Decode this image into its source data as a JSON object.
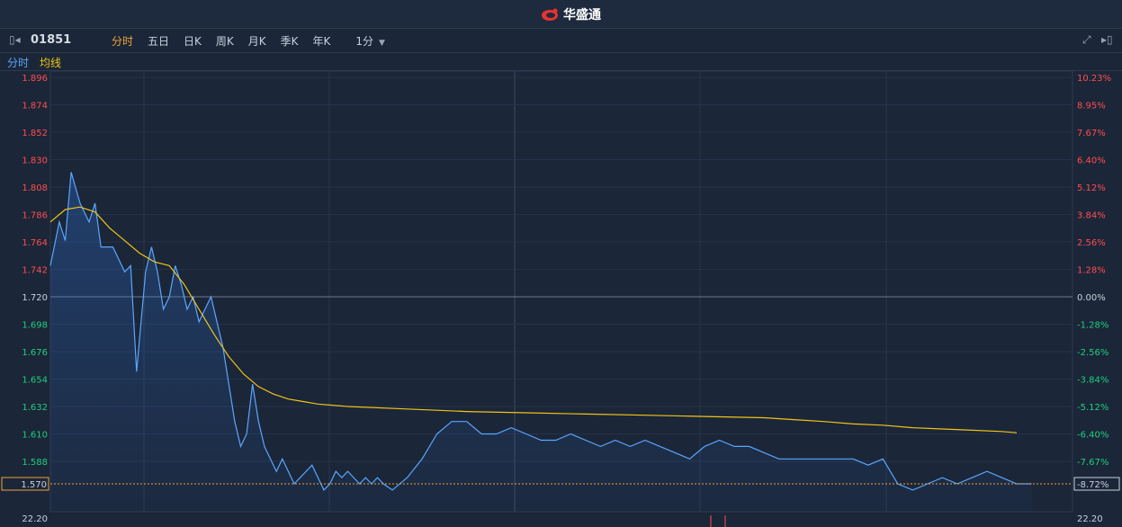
{
  "header": {
    "brand": "华盛通"
  },
  "toolbar": {
    "symbol": "01851",
    "tabs": [
      "分时",
      "五日",
      "日K",
      "周K",
      "月K",
      "季K",
      "年K"
    ],
    "interval": "1分"
  },
  "legend": {
    "series1": "分时",
    "series2": "均线"
  },
  "colors": {
    "background": "#1b2638",
    "price_line": "#5aa6ff",
    "avg_line": "#f0c419",
    "up": "#ff4d4f",
    "down": "#1fcf7e",
    "neutral": "#c9d1dc",
    "current_marker": "#f0a23a"
  },
  "chart_data": {
    "type": "line",
    "prev_close": 1.72,
    "current_price": 1.57,
    "current_pct": "-8.72%",
    "ylim": [
      1.565,
      1.9
    ],
    "left_ticks": [
      "1.896",
      "1.874",
      "1.852",
      "1.830",
      "1.808",
      "1.786",
      "1.764",
      "1.742",
      "1.720",
      "1.698",
      "1.676",
      "1.654",
      "1.632",
      "1.610",
      "1.588",
      "1.570"
    ],
    "right_ticks": [
      "10.23%",
      "8.95%",
      "7.67%",
      "6.40%",
      "5.12%",
      "3.84%",
      "2.56%",
      "1.28%",
      "0.00%",
      "-1.28%",
      "-2.56%",
      "-3.84%",
      "-5.12%",
      "-6.40%",
      "-7.67%",
      "-8.72%"
    ],
    "volume_label_left": "22.20",
    "volume_label_right": "22.20",
    "x_minutes": 330,
    "series": [
      {
        "name": "分时",
        "x": [
          0,
          3,
          5,
          7,
          10,
          13,
          15,
          17,
          19,
          21,
          23,
          25,
          27,
          29,
          32,
          34,
          36,
          38,
          40,
          42,
          44,
          46,
          48,
          50,
          52,
          54,
          56,
          58,
          60,
          62,
          64,
          66,
          68,
          70,
          72,
          74,
          76,
          78,
          80,
          82,
          84,
          86,
          88,
          90,
          92,
          94,
          96,
          98,
          100,
          102,
          104,
          106,
          108,
          110,
          112,
          115,
          120,
          125,
          130,
          135,
          140,
          145,
          150,
          155,
          160,
          165,
          170,
          175,
          180,
          185,
          190,
          195,
          200,
          205,
          210,
          215,
          220,
          225,
          230,
          235,
          240,
          245,
          250,
          255,
          260,
          265,
          270,
          275,
          280,
          285,
          290,
          295,
          300,
          305,
          310,
          315,
          320,
          325,
          330
        ],
        "values": [
          1.745,
          1.78,
          1.765,
          1.82,
          1.795,
          1.78,
          1.795,
          1.76,
          1.76,
          1.76,
          1.75,
          1.74,
          1.745,
          1.66,
          1.74,
          1.76,
          1.74,
          1.71,
          1.72,
          1.745,
          1.73,
          1.71,
          1.72,
          1.7,
          1.71,
          1.72,
          1.7,
          1.68,
          1.65,
          1.62,
          1.6,
          1.61,
          1.65,
          1.62,
          1.6,
          1.59,
          1.58,
          1.59,
          1.58,
          1.57,
          1.575,
          1.58,
          1.585,
          1.575,
          1.565,
          1.57,
          1.58,
          1.575,
          1.58,
          1.575,
          1.57,
          1.575,
          1.57,
          1.575,
          1.57,
          1.565,
          1.575,
          1.59,
          1.61,
          1.62,
          1.62,
          1.61,
          1.61,
          1.615,
          1.61,
          1.605,
          1.605,
          1.61,
          1.605,
          1.6,
          1.605,
          1.6,
          1.605,
          1.6,
          1.595,
          1.59,
          1.6,
          1.605,
          1.6,
          1.6,
          1.595,
          1.59,
          1.59,
          1.59,
          1.59,
          1.59,
          1.59,
          1.585,
          1.59,
          1.57,
          1.565,
          1.57,
          1.575,
          1.57,
          1.575,
          1.58,
          1.575,
          1.57,
          1.57
        ]
      },
      {
        "name": "均线",
        "x": [
          0,
          5,
          10,
          15,
          20,
          25,
          30,
          35,
          40,
          45,
          50,
          55,
          60,
          65,
          70,
          75,
          80,
          85,
          90,
          100,
          120,
          140,
          160,
          180,
          200,
          220,
          240,
          260,
          270,
          280,
          290,
          300,
          310,
          320,
          325
        ],
        "values": [
          1.78,
          1.79,
          1.792,
          1.788,
          1.775,
          1.765,
          1.755,
          1.748,
          1.745,
          1.73,
          1.71,
          1.69,
          1.672,
          1.658,
          1.648,
          1.642,
          1.638,
          1.636,
          1.634,
          1.632,
          1.63,
          1.628,
          1.627,
          1.626,
          1.625,
          1.624,
          1.623,
          1.62,
          1.618,
          1.617,
          1.615,
          1.614,
          1.613,
          1.612,
          1.611
        ]
      }
    ]
  }
}
